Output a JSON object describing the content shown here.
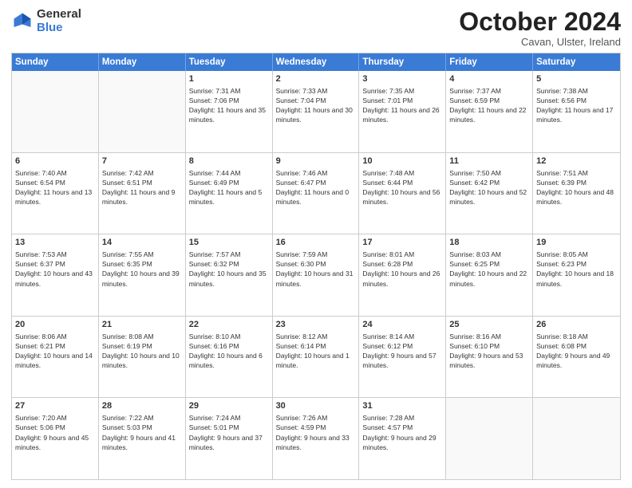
{
  "logo": {
    "general": "General",
    "blue": "Blue"
  },
  "header": {
    "month": "October 2024",
    "location": "Cavan, Ulster, Ireland"
  },
  "weekdays": [
    "Sunday",
    "Monday",
    "Tuesday",
    "Wednesday",
    "Thursday",
    "Friday",
    "Saturday"
  ],
  "rows": [
    [
      {
        "day": "",
        "sunrise": "",
        "sunset": "",
        "daylight": ""
      },
      {
        "day": "",
        "sunrise": "",
        "sunset": "",
        "daylight": ""
      },
      {
        "day": "1",
        "sunrise": "Sunrise: 7:31 AM",
        "sunset": "Sunset: 7:06 PM",
        "daylight": "Daylight: 11 hours and 35 minutes."
      },
      {
        "day": "2",
        "sunrise": "Sunrise: 7:33 AM",
        "sunset": "Sunset: 7:04 PM",
        "daylight": "Daylight: 11 hours and 30 minutes."
      },
      {
        "day": "3",
        "sunrise": "Sunrise: 7:35 AM",
        "sunset": "Sunset: 7:01 PM",
        "daylight": "Daylight: 11 hours and 26 minutes."
      },
      {
        "day": "4",
        "sunrise": "Sunrise: 7:37 AM",
        "sunset": "Sunset: 6:59 PM",
        "daylight": "Daylight: 11 hours and 22 minutes."
      },
      {
        "day": "5",
        "sunrise": "Sunrise: 7:38 AM",
        "sunset": "Sunset: 6:56 PM",
        "daylight": "Daylight: 11 hours and 17 minutes."
      }
    ],
    [
      {
        "day": "6",
        "sunrise": "Sunrise: 7:40 AM",
        "sunset": "Sunset: 6:54 PM",
        "daylight": "Daylight: 11 hours and 13 minutes."
      },
      {
        "day": "7",
        "sunrise": "Sunrise: 7:42 AM",
        "sunset": "Sunset: 6:51 PM",
        "daylight": "Daylight: 11 hours and 9 minutes."
      },
      {
        "day": "8",
        "sunrise": "Sunrise: 7:44 AM",
        "sunset": "Sunset: 6:49 PM",
        "daylight": "Daylight: 11 hours and 5 minutes."
      },
      {
        "day": "9",
        "sunrise": "Sunrise: 7:46 AM",
        "sunset": "Sunset: 6:47 PM",
        "daylight": "Daylight: 11 hours and 0 minutes."
      },
      {
        "day": "10",
        "sunrise": "Sunrise: 7:48 AM",
        "sunset": "Sunset: 6:44 PM",
        "daylight": "Daylight: 10 hours and 56 minutes."
      },
      {
        "day": "11",
        "sunrise": "Sunrise: 7:50 AM",
        "sunset": "Sunset: 6:42 PM",
        "daylight": "Daylight: 10 hours and 52 minutes."
      },
      {
        "day": "12",
        "sunrise": "Sunrise: 7:51 AM",
        "sunset": "Sunset: 6:39 PM",
        "daylight": "Daylight: 10 hours and 48 minutes."
      }
    ],
    [
      {
        "day": "13",
        "sunrise": "Sunrise: 7:53 AM",
        "sunset": "Sunset: 6:37 PM",
        "daylight": "Daylight: 10 hours and 43 minutes."
      },
      {
        "day": "14",
        "sunrise": "Sunrise: 7:55 AM",
        "sunset": "Sunset: 6:35 PM",
        "daylight": "Daylight: 10 hours and 39 minutes."
      },
      {
        "day": "15",
        "sunrise": "Sunrise: 7:57 AM",
        "sunset": "Sunset: 6:32 PM",
        "daylight": "Daylight: 10 hours and 35 minutes."
      },
      {
        "day": "16",
        "sunrise": "Sunrise: 7:59 AM",
        "sunset": "Sunset: 6:30 PM",
        "daylight": "Daylight: 10 hours and 31 minutes."
      },
      {
        "day": "17",
        "sunrise": "Sunrise: 8:01 AM",
        "sunset": "Sunset: 6:28 PM",
        "daylight": "Daylight: 10 hours and 26 minutes."
      },
      {
        "day": "18",
        "sunrise": "Sunrise: 8:03 AM",
        "sunset": "Sunset: 6:25 PM",
        "daylight": "Daylight: 10 hours and 22 minutes."
      },
      {
        "day": "19",
        "sunrise": "Sunrise: 8:05 AM",
        "sunset": "Sunset: 6:23 PM",
        "daylight": "Daylight: 10 hours and 18 minutes."
      }
    ],
    [
      {
        "day": "20",
        "sunrise": "Sunrise: 8:06 AM",
        "sunset": "Sunset: 6:21 PM",
        "daylight": "Daylight: 10 hours and 14 minutes."
      },
      {
        "day": "21",
        "sunrise": "Sunrise: 8:08 AM",
        "sunset": "Sunset: 6:19 PM",
        "daylight": "Daylight: 10 hours and 10 minutes."
      },
      {
        "day": "22",
        "sunrise": "Sunrise: 8:10 AM",
        "sunset": "Sunset: 6:16 PM",
        "daylight": "Daylight: 10 hours and 6 minutes."
      },
      {
        "day": "23",
        "sunrise": "Sunrise: 8:12 AM",
        "sunset": "Sunset: 6:14 PM",
        "daylight": "Daylight: 10 hours and 1 minute."
      },
      {
        "day": "24",
        "sunrise": "Sunrise: 8:14 AM",
        "sunset": "Sunset: 6:12 PM",
        "daylight": "Daylight: 9 hours and 57 minutes."
      },
      {
        "day": "25",
        "sunrise": "Sunrise: 8:16 AM",
        "sunset": "Sunset: 6:10 PM",
        "daylight": "Daylight: 9 hours and 53 minutes."
      },
      {
        "day": "26",
        "sunrise": "Sunrise: 8:18 AM",
        "sunset": "Sunset: 6:08 PM",
        "daylight": "Daylight: 9 hours and 49 minutes."
      }
    ],
    [
      {
        "day": "27",
        "sunrise": "Sunrise: 7:20 AM",
        "sunset": "Sunset: 5:06 PM",
        "daylight": "Daylight: 9 hours and 45 minutes."
      },
      {
        "day": "28",
        "sunrise": "Sunrise: 7:22 AM",
        "sunset": "Sunset: 5:03 PM",
        "daylight": "Daylight: 9 hours and 41 minutes."
      },
      {
        "day": "29",
        "sunrise": "Sunrise: 7:24 AM",
        "sunset": "Sunset: 5:01 PM",
        "daylight": "Daylight: 9 hours and 37 minutes."
      },
      {
        "day": "30",
        "sunrise": "Sunrise: 7:26 AM",
        "sunset": "Sunset: 4:59 PM",
        "daylight": "Daylight: 9 hours and 33 minutes."
      },
      {
        "day": "31",
        "sunrise": "Sunrise: 7:28 AM",
        "sunset": "Sunset: 4:57 PM",
        "daylight": "Daylight: 9 hours and 29 minutes."
      },
      {
        "day": "",
        "sunrise": "",
        "sunset": "",
        "daylight": ""
      },
      {
        "day": "",
        "sunrise": "",
        "sunset": "",
        "daylight": ""
      }
    ]
  ]
}
